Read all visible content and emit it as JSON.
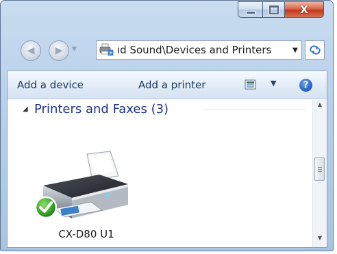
{
  "window": {
    "caption": {
      "minimize": "minimize",
      "maximize": "maximize",
      "close": "X"
    }
  },
  "navigation": {
    "address_text": "ıd Sound\\Devices and Printers",
    "address_icon": "devices-printers-icon"
  },
  "commandbar": {
    "add_device": "Add a device",
    "add_printer": "Add a printer",
    "help_label": "?"
  },
  "group": {
    "title": "Printers and Faxes (3)"
  },
  "devices": [
    {
      "name": "CX-D80 U1",
      "icon": "printer-icon",
      "status": "default-check-icon"
    }
  ],
  "colors": {
    "group_title": "#1e3287",
    "command_text": "#1e395b",
    "close_button": "#c3381c",
    "frame": "#b7cfe9"
  }
}
